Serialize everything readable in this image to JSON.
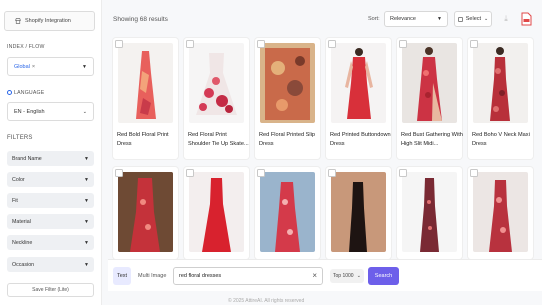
{
  "sidebar": {
    "shopify_label": "Shopify Integration",
    "index_label": "INDEX / FLOW",
    "index_tag": "Global",
    "language_label": "LANGUAGE",
    "language_value": "EN - English",
    "filters_title": "FILTERS",
    "filters": [
      "Brand Name",
      "Color",
      "Fit",
      "Material",
      "Neckline",
      "Occasion"
    ],
    "save_filter_label": "Save Filter (Lite)"
  },
  "header": {
    "showing": "Showing 68 results",
    "sort_label": "Sort:",
    "sort_value": "Relevance",
    "select_label": "Select"
  },
  "products_row1": [
    {
      "title": "Red Bold Floral Print Dress"
    },
    {
      "title": "Red Floral Print Shoulder Tie Up Skate..."
    },
    {
      "title": "Red Floral Printed Slip Dress"
    },
    {
      "title": "Red Printed Buttondown Dress"
    },
    {
      "title": "Red Bust Gathering With High Slit Midi..."
    },
    {
      "title": "Red Boho V Neck Maxi Dress"
    }
  ],
  "search": {
    "mode_text": "Text",
    "mode_multi": "Multi Image",
    "query": "red floral dresses",
    "top_label": "Top 1000",
    "search_label": "Search"
  },
  "footer": "© 2025 AttireAI. All rights reserved",
  "colors": {
    "accent": "#6d5fea",
    "link": "#2a66e8",
    "pdf": "#e04848"
  }
}
